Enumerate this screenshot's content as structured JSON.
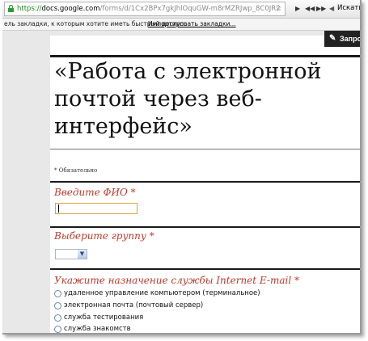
{
  "browser": {
    "url_scheme": "https://",
    "url_host": "docs.google.com",
    "url_path": "/forms/d/1Cx2BPx7gkJhlOquGW-m8rMZRJwp_8C0JR2",
    "search_placeholder": "Искать",
    "bookmarks_text": "ель закладки, к которым хотите иметь быстрый доступ.",
    "bookmarks_import": "Импортировать закладки..."
  },
  "form": {
    "edit_label": "Запро",
    "title": "«Работа с электронной почтой через веб-интерфейс»",
    "required_note": "* Обязательно",
    "q1": {
      "label": "Введите ФИО",
      "star": "*",
      "value": ""
    },
    "q2": {
      "label": "Выберите группу",
      "star": "*",
      "selected": ""
    },
    "q3": {
      "label": "Укажите назначение службы Internet E-mail",
      "star": "*",
      "options": [
        "удаленное управление компьютером (терминальное)",
        "электронная почта (почтовый сервер)",
        "служба тестирования",
        "служба знакомств"
      ]
    }
  }
}
